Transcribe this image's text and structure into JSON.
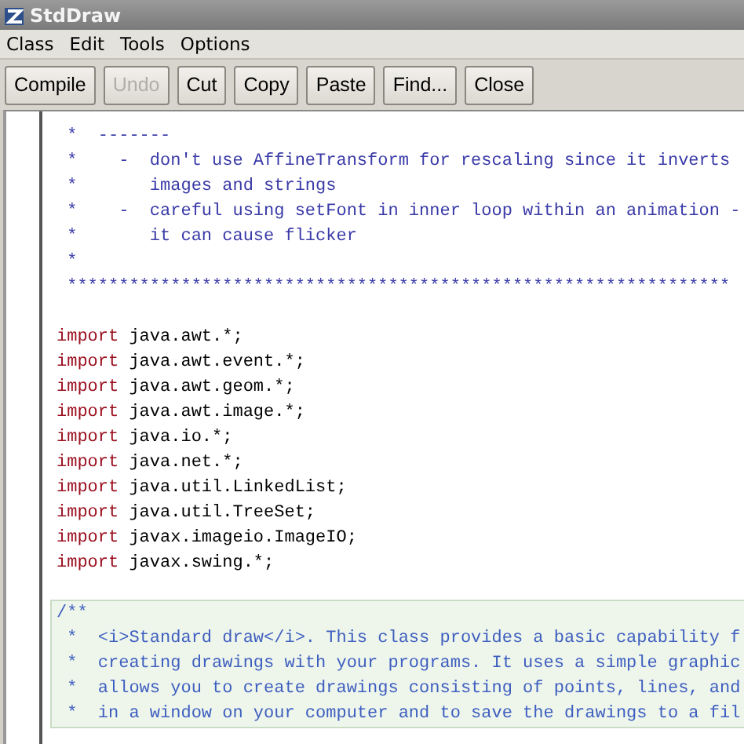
{
  "window": {
    "title": "StdDraw"
  },
  "menu": [
    "Class",
    "Edit",
    "Tools",
    "Options"
  ],
  "toolbar": [
    {
      "label": "Compile",
      "disabled": false
    },
    {
      "label": "Undo",
      "disabled": true
    },
    {
      "label": "Cut",
      "disabled": false
    },
    {
      "label": "Copy",
      "disabled": false
    },
    {
      "label": "Paste",
      "disabled": false
    },
    {
      "label": "Find...",
      "disabled": false
    },
    {
      "label": "Close",
      "disabled": false
    }
  ],
  "editor": {
    "blocks": [
      {
        "kind": "comment",
        "lines": [
          " *  -------",
          " *    -  don't use AffineTransform for rescaling since it inverts",
          " *       images and strings",
          " *    -  careful using setFont in inner loop within an animation -",
          " *       it can cause flicker",
          " *",
          " ****************************************************************"
        ]
      },
      {
        "kind": "code",
        "lines": [
          {
            "keyword": "import",
            "rest": " java.awt.*;"
          },
          {
            "keyword": "import",
            "rest": " java.awt.event.*;"
          },
          {
            "keyword": "import",
            "rest": " java.awt.geom.*;"
          },
          {
            "keyword": "import",
            "rest": " java.awt.image.*;"
          },
          {
            "keyword": "import",
            "rest": " java.io.*;"
          },
          {
            "keyword": "import",
            "rest": " java.net.*;"
          },
          {
            "keyword": "import",
            "rest": " java.util.LinkedList;"
          },
          {
            "keyword": "import",
            "rest": " java.util.TreeSet;"
          },
          {
            "keyword": "import",
            "rest": " javax.imageio.ImageIO;"
          },
          {
            "keyword": "import",
            "rest": " javax.swing.*;"
          }
        ]
      },
      {
        "kind": "doc",
        "lines": [
          "/**",
          " *  <i>Standard draw</i>. This class provides a basic capability f",
          " *  creating drawings with your programs. It uses a simple graphic",
          " *  allows you to create drawings consisting of points, lines, and",
          " *  in a window on your computer and to save the drawings to a fil"
        ]
      }
    ]
  }
}
